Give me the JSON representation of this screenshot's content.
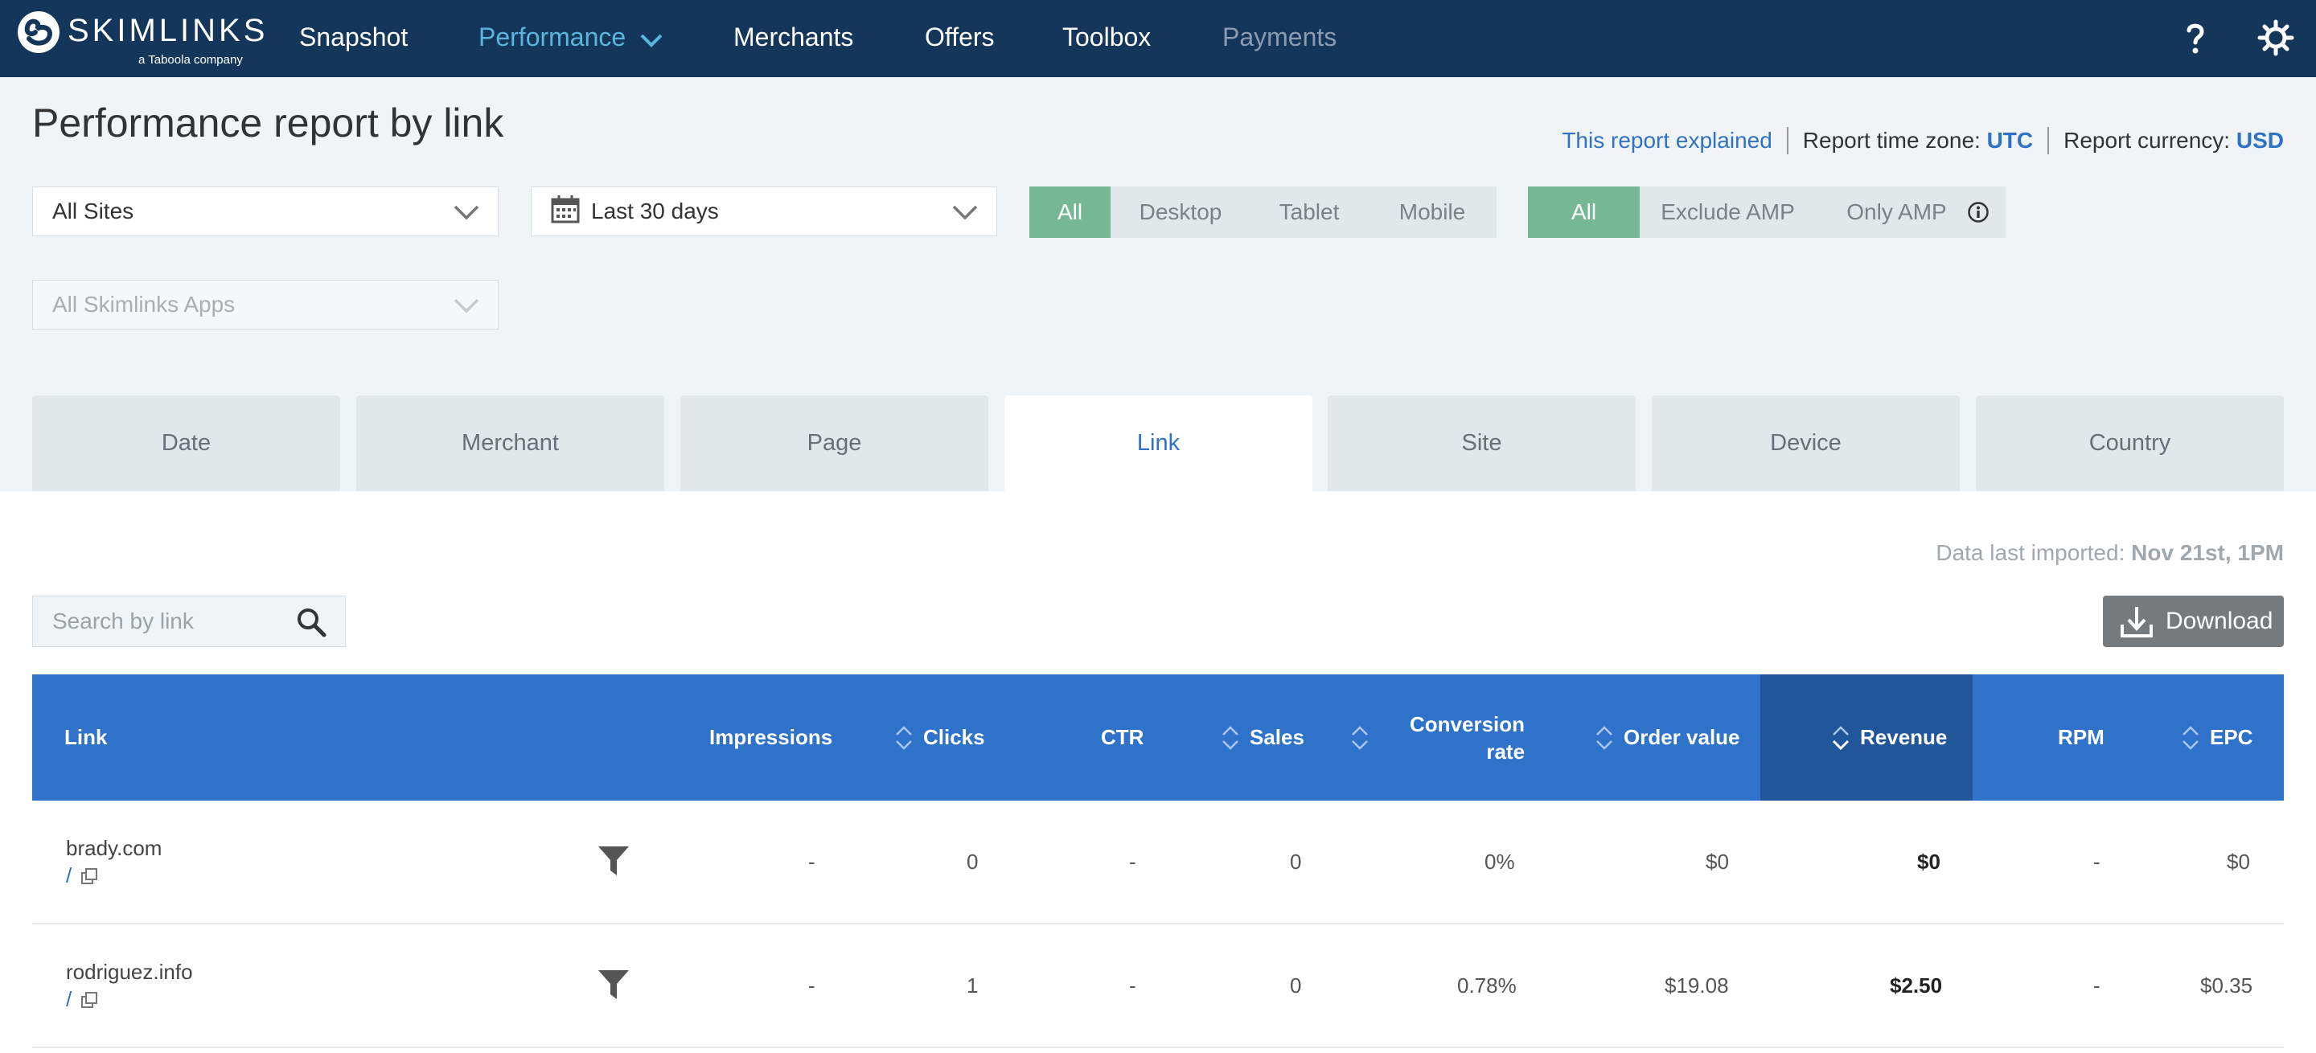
{
  "brand": {
    "name": "SKIMLINKS",
    "tagline": "a Taboola company"
  },
  "nav": {
    "items": [
      {
        "label": "Snapshot"
      },
      {
        "label": "Performance"
      },
      {
        "label": "Merchants"
      },
      {
        "label": "Offers"
      },
      {
        "label": "Toolbox"
      },
      {
        "label": "Payments"
      }
    ],
    "icons": [
      "help-icon",
      "settings-gear-icon"
    ]
  },
  "header": {
    "title": "Performance report by link",
    "report_explained": "This report explained",
    "timezone_label": "Report time zone:",
    "timezone_value": "UTC",
    "currency_label": "Report currency:",
    "currency_value": "USD"
  },
  "filters": {
    "sites": "All Sites",
    "date_range": "Last 30 days",
    "apps": "All Skimlinks Apps",
    "device": [
      "All",
      "Desktop",
      "Tablet",
      "Mobile"
    ],
    "device_selected": "All",
    "amp": [
      "All",
      "Exclude AMP",
      "Only AMP"
    ],
    "amp_selected": "All"
  },
  "tabs": [
    "Date",
    "Merchant",
    "Page",
    "Link",
    "Site",
    "Device",
    "Country"
  ],
  "active_tab": "Link",
  "data_import": {
    "label": "Data last imported:",
    "value": "Nov 21st, 1PM"
  },
  "search": {
    "placeholder": "Search by link"
  },
  "download_label": "Download",
  "table": {
    "columns": {
      "link": "Link",
      "impressions": "Impressions",
      "clicks": "Clicks",
      "ctr": "CTR",
      "sales": "Sales",
      "conversion_line1": "Conversion",
      "conversion_line2": "rate",
      "order_value": "Order value",
      "revenue": "Revenue",
      "rpm": "RPM",
      "epc": "EPC"
    },
    "sorted_column": "Revenue",
    "rows": [
      {
        "link": "brady.com",
        "path": "/",
        "impressions": "-",
        "clicks": "0",
        "ctr": "-",
        "sales": "0",
        "conversion": "0%",
        "order_value": "$0",
        "revenue": "$0",
        "rpm": "-",
        "epc": "$0"
      },
      {
        "link": "rodriguez.info",
        "path": "/",
        "impressions": "-",
        "clicks": "1",
        "ctr": "-",
        "sales": "0",
        "conversion": "0.78%",
        "order_value": "$19.08",
        "revenue": "$2.50",
        "rpm": "-",
        "epc": "$0.35"
      }
    ]
  },
  "colors": {
    "nav_bg": "#14365a",
    "nav_active": "#5bb5dd",
    "accent_blue": "#2f72c5",
    "table_header": "#2f72c9",
    "sorted_header": "#22569a",
    "toggle_on": "#76b896",
    "download_bg": "#767a7d"
  }
}
